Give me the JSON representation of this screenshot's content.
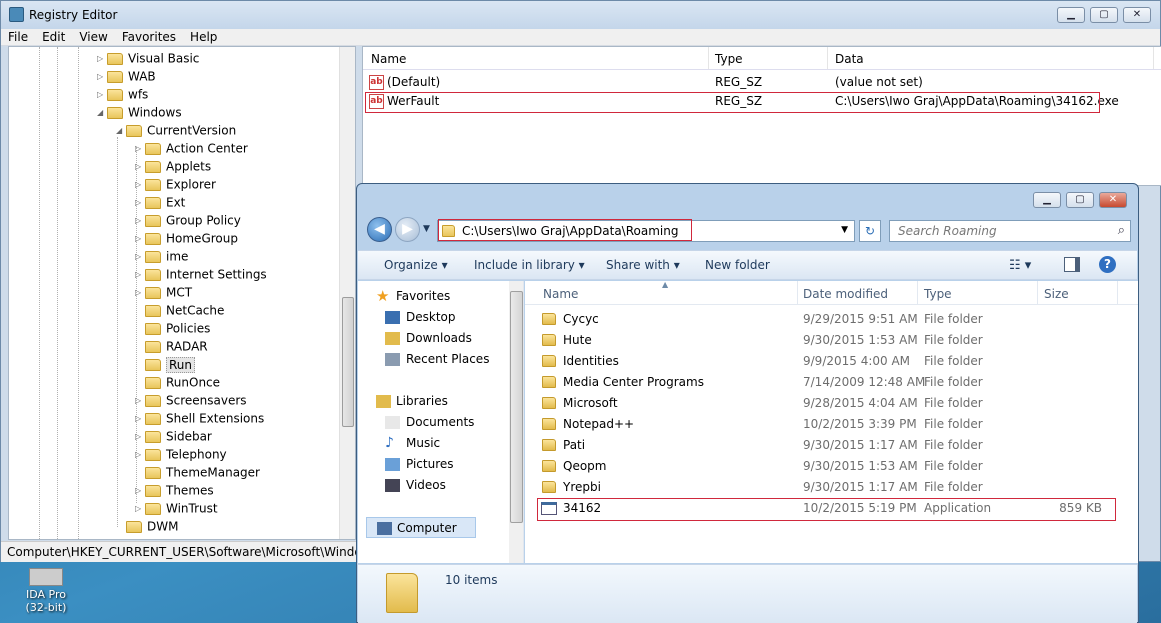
{
  "registry": {
    "title": "Registry Editor",
    "menu": [
      "File",
      "Edit",
      "View",
      "Favorites",
      "Help"
    ],
    "window_buttons": {
      "minimize": "▁",
      "maximize": "▢",
      "close": "✕"
    },
    "tree": [
      {
        "label": "Visual Basic",
        "level": 1,
        "expander": "▷"
      },
      {
        "label": "WAB",
        "level": 1,
        "expander": "▷"
      },
      {
        "label": "wfs",
        "level": 1,
        "expander": "▷"
      },
      {
        "label": "Windows",
        "level": 1,
        "expander": "◢"
      },
      {
        "label": "CurrentVersion",
        "level": 2,
        "expander": "◢"
      },
      {
        "label": "Action Center",
        "level": 3,
        "expander": "▷"
      },
      {
        "label": "Applets",
        "level": 3,
        "expander": "▷"
      },
      {
        "label": "Explorer",
        "level": 3,
        "expander": "▷"
      },
      {
        "label": "Ext",
        "level": 3,
        "expander": "▷"
      },
      {
        "label": "Group Policy",
        "level": 3,
        "expander": "▷"
      },
      {
        "label": "HomeGroup",
        "level": 3,
        "expander": "▷"
      },
      {
        "label": "ime",
        "level": 3,
        "expander": "▷"
      },
      {
        "label": "Internet Settings",
        "level": 3,
        "expander": "▷"
      },
      {
        "label": "MCT",
        "level": 3,
        "expander": "▷"
      },
      {
        "label": "NetCache",
        "level": 3,
        "expander": ""
      },
      {
        "label": "Policies",
        "level": 3,
        "expander": ""
      },
      {
        "label": "RADAR",
        "level": 3,
        "expander": ""
      },
      {
        "label": "Run",
        "level": 3,
        "expander": "",
        "selected": true
      },
      {
        "label": "RunOnce",
        "level": 3,
        "expander": ""
      },
      {
        "label": "Screensavers",
        "level": 3,
        "expander": "▷"
      },
      {
        "label": "Shell Extensions",
        "level": 3,
        "expander": "▷"
      },
      {
        "label": "Sidebar",
        "level": 3,
        "expander": "▷"
      },
      {
        "label": "Telephony",
        "level": 3,
        "expander": "▷"
      },
      {
        "label": "ThemeManager",
        "level": 3,
        "expander": ""
      },
      {
        "label": "Themes",
        "level": 3,
        "expander": "▷"
      },
      {
        "label": "WinTrust",
        "level": 3,
        "expander": "▷"
      },
      {
        "label": "DWM",
        "level": 2,
        "expander": ""
      }
    ],
    "values_header": {
      "name": "Name",
      "type": "Type",
      "data": "Data"
    },
    "values": [
      {
        "name": "(Default)",
        "type": "REG_SZ",
        "data": "(value not set)"
      },
      {
        "name": "WerFault",
        "type": "REG_SZ",
        "data": "C:\\Users\\Iwo Graj\\AppData\\Roaming\\34162.exe",
        "highlighted": true
      }
    ],
    "value_icon": "ab",
    "status": "Computer\\HKEY_CURRENT_USER\\Software\\Microsoft\\Windows\\C"
  },
  "explorer": {
    "window_buttons": {
      "minimize": "▁",
      "maximize": "▢",
      "close": "✕"
    },
    "address": "C:\\Users\\Iwo Graj\\AppData\\Roaming",
    "search_placeholder": "Search Roaming",
    "toolbar": {
      "organize": "Organize ▾",
      "include": "Include in library ▾",
      "share": "Share with ▾",
      "new_folder": "New folder"
    },
    "nav": [
      {
        "label": "Favorites",
        "icon": "star-icon",
        "group": true
      },
      {
        "label": "Desktop",
        "icon": "desktop-icon"
      },
      {
        "label": "Downloads",
        "icon": "downloads-icon"
      },
      {
        "label": "Recent Places",
        "icon": "recent-places-icon"
      },
      {
        "label": "Libraries",
        "icon": "libraries-icon",
        "group": true
      },
      {
        "label": "Documents",
        "icon": "documents-icon"
      },
      {
        "label": "Music",
        "icon": "music-icon"
      },
      {
        "label": "Pictures",
        "icon": "pictures-icon"
      },
      {
        "label": "Videos",
        "icon": "videos-icon"
      },
      {
        "label": "Computer",
        "icon": "computer-icon",
        "group": true,
        "selected": true
      }
    ],
    "columns": {
      "name": "Name",
      "date": "Date modified",
      "type": "Type",
      "size": "Size"
    },
    "files": [
      {
        "name": "Cycyc",
        "date": "9/29/2015 9:51 AM",
        "type": "File folder",
        "size": ""
      },
      {
        "name": "Hute",
        "date": "9/30/2015 1:53 AM",
        "type": "File folder",
        "size": ""
      },
      {
        "name": "Identities",
        "date": "9/9/2015 4:00 AM",
        "type": "File folder",
        "size": ""
      },
      {
        "name": "Media Center Programs",
        "date": "7/14/2009 12:48 AM",
        "type": "File folder",
        "size": ""
      },
      {
        "name": "Microsoft",
        "date": "9/28/2015 4:04 AM",
        "type": "File folder",
        "size": ""
      },
      {
        "name": "Notepad++",
        "date": "10/2/2015 3:39 PM",
        "type": "File folder",
        "size": ""
      },
      {
        "name": "Pati",
        "date": "9/30/2015 1:17 AM",
        "type": "File folder",
        "size": ""
      },
      {
        "name": "Qeopm",
        "date": "9/30/2015 1:53 AM",
        "type": "File folder",
        "size": ""
      },
      {
        "name": "Yrepbi",
        "date": "9/30/2015 1:17 AM",
        "type": "File folder",
        "size": ""
      },
      {
        "name": "34162",
        "date": "10/2/2015 5:19 PM",
        "type": "Application",
        "size": "859 KB",
        "highlighted": true
      }
    ],
    "item_count": "10 items"
  },
  "desktop_icon": {
    "line1": "IDA Pro",
    "line2": "(32-bit)"
  }
}
